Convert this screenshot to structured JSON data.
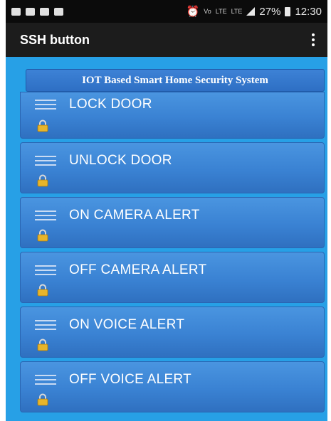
{
  "status_bar": {
    "battery": "27%",
    "time": "12:30",
    "network_labels": [
      "Vo",
      "LTE",
      "LTE"
    ]
  },
  "app_bar": {
    "title": "SSH button",
    "menu_icon": "overflow-menu-icon"
  },
  "banner": {
    "title": "IOT Based Smart Home Security System"
  },
  "actions": [
    {
      "label": "LOCK DOOR",
      "icon": "lock-icon"
    },
    {
      "label": "UNLOCK DOOR",
      "icon": "lock-icon"
    },
    {
      "label": "ON CAMERA ALERT",
      "icon": "lock-icon"
    },
    {
      "label": "OFF CAMERA ALERT",
      "icon": "lock-icon"
    },
    {
      "label": "ON VOICE ALERT",
      "icon": "lock-icon"
    },
    {
      "label": "OFF VOICE ALERT",
      "icon": "lock-icon"
    }
  ],
  "colors": {
    "background": "#27a0e6",
    "button": "#3a82d3",
    "app_bar": "#1c1c1c",
    "lock": "#e8b52a"
  }
}
